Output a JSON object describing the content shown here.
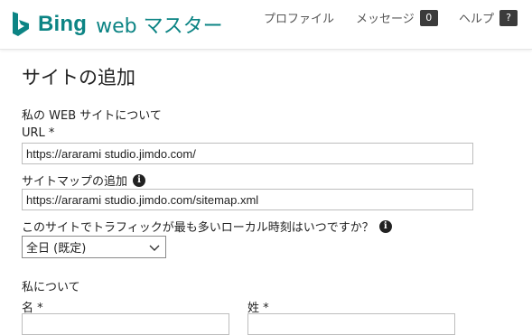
{
  "header": {
    "brand": "Bing",
    "product": "web マスター",
    "nav": [
      {
        "label": "プロファイル"
      },
      {
        "label": "メッセージ",
        "badge": "0"
      },
      {
        "label": "ヘルプ",
        "badge": "?"
      }
    ]
  },
  "page": {
    "title": "サイトの追加",
    "website_section": "私の WEB サイトについて",
    "url_label": "URL *",
    "url_value": "https://ararami studio.jimdo.com/",
    "sitemap_label": "サイトマップの追加",
    "sitemap_value": "https://ararami studio.jimdo.com/sitemap.xml",
    "traffic_question": "このサイトでトラフィックが最も多いローカル時刻はいつですか？",
    "traffic_select": "全日 (既定)",
    "about_section": "私について",
    "first_name_label": "名 *",
    "last_name_label": "姓 *"
  },
  "colors": {
    "brand": "#0c8484"
  }
}
